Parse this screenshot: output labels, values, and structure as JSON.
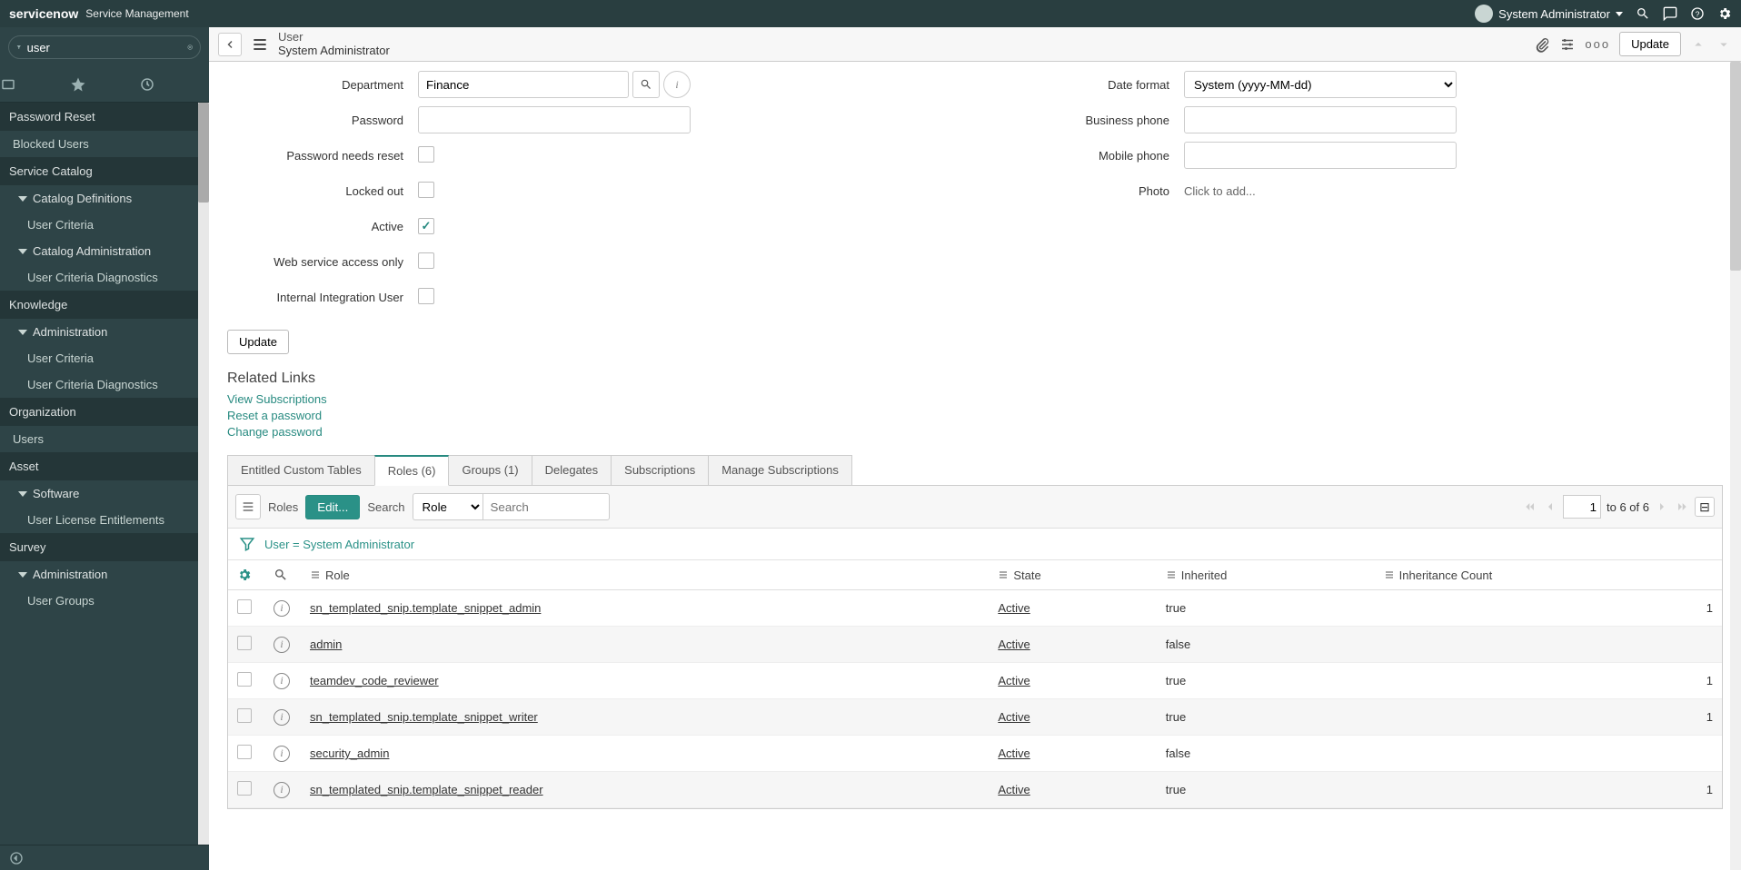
{
  "banner": {
    "logo": "servicenow",
    "product": "Service Management",
    "user_name": "System Administrator"
  },
  "nav": {
    "filter_value": "user",
    "tree": [
      {
        "type": "app",
        "label": "Password Reset"
      },
      {
        "type": "module_top",
        "label": "Blocked Users"
      },
      {
        "type": "app",
        "label": "Service Catalog"
      },
      {
        "type": "group",
        "label": "Catalog Definitions"
      },
      {
        "type": "module",
        "label": "User Criteria"
      },
      {
        "type": "group",
        "label": "Catalog Administration"
      },
      {
        "type": "module",
        "label": "User Criteria Diagnostics"
      },
      {
        "type": "app",
        "label": "Knowledge"
      },
      {
        "type": "group",
        "label": "Administration"
      },
      {
        "type": "module",
        "label": "User Criteria"
      },
      {
        "type": "module",
        "label": "User Criteria Diagnostics"
      },
      {
        "type": "app",
        "label": "Organization"
      },
      {
        "type": "module_top",
        "label": "Users"
      },
      {
        "type": "app",
        "label": "Asset"
      },
      {
        "type": "group",
        "label": "Software"
      },
      {
        "type": "module",
        "label": "User License Entitlements"
      },
      {
        "type": "app",
        "label": "Survey"
      },
      {
        "type": "group",
        "label": "Administration"
      },
      {
        "type": "module",
        "label": "User Groups"
      }
    ]
  },
  "header": {
    "title": "User",
    "subtitle": "System Administrator",
    "update_label": "Update",
    "more_label": "ooo"
  },
  "form": {
    "left": {
      "department_label": "Department",
      "department_value": "Finance",
      "password_label": "Password",
      "needs_reset_label": "Password needs reset",
      "locked_label": "Locked out",
      "active_label": "Active",
      "ws_label": "Web service access only",
      "iiu_label": "Internal Integration User"
    },
    "right": {
      "dateformat_label": "Date format",
      "dateformat_value": "System (yyyy-MM-dd)",
      "bphone_label": "Business phone",
      "mphone_label": "Mobile phone",
      "photo_label": "Photo",
      "photo_text": "Click to add..."
    }
  },
  "buttons": {
    "update": "Update"
  },
  "related_links": {
    "title": "Related Links",
    "items": [
      "View Subscriptions",
      "Reset a password",
      "Change password"
    ]
  },
  "tabs": [
    {
      "label": "Entitled Custom Tables",
      "active": false
    },
    {
      "label": "Roles (6)",
      "active": true
    },
    {
      "label": "Groups (1)",
      "active": false
    },
    {
      "label": "Delegates",
      "active": false
    },
    {
      "label": "Subscriptions",
      "active": false
    },
    {
      "label": "Manage Subscriptions",
      "active": false
    }
  ],
  "list": {
    "title": "Roles",
    "edit_label": "Edit...",
    "search_label": "Search",
    "search_field": "Role",
    "search_placeholder": "Search",
    "page_current": "1",
    "page_info": "to 6 of 6",
    "breadcrumb": "User = System Administrator",
    "columns": [
      "Role",
      "State",
      "Inherited",
      "Inheritance Count"
    ],
    "rows": [
      {
        "role": "sn_templated_snip.template_snippet_admin",
        "state": "Active",
        "inherited": "true",
        "count": "1"
      },
      {
        "role": "admin",
        "state": "Active",
        "inherited": "false",
        "count": ""
      },
      {
        "role": "teamdev_code_reviewer",
        "state": "Active",
        "inherited": "true",
        "count": "1"
      },
      {
        "role": "sn_templated_snip.template_snippet_writer",
        "state": "Active",
        "inherited": "true",
        "count": "1"
      },
      {
        "role": "security_admin",
        "state": "Active",
        "inherited": "false",
        "count": ""
      },
      {
        "role": "sn_templated_snip.template_snippet_reader",
        "state": "Active",
        "inherited": "true",
        "count": "1"
      }
    ]
  }
}
